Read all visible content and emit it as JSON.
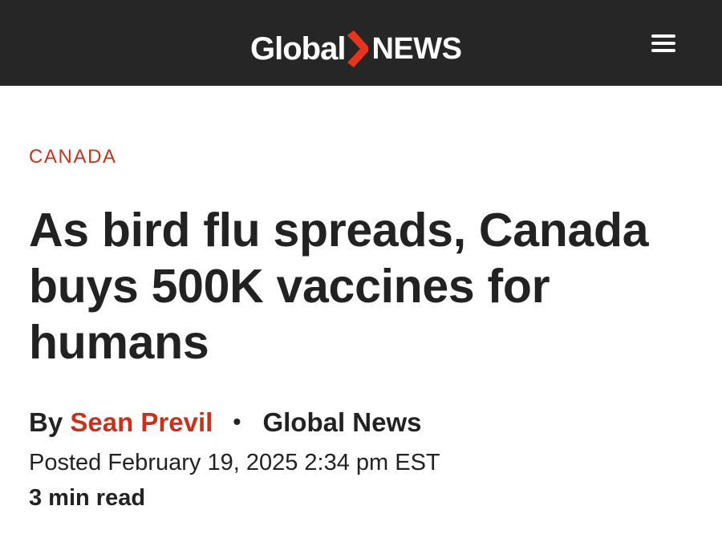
{
  "header": {
    "logo_global": "Global",
    "logo_news": "NEWS",
    "menu_icon": "hamburger-menu-icon",
    "background_color": "#262626",
    "accent_color": "#e8341c"
  },
  "article": {
    "section": "CANADA",
    "headline": "As bird flu spreads, Canada buys 500K vaccines for humans",
    "byline_prefix": "By",
    "author": "Sean Previl",
    "separator": "•",
    "outlet": "Global News",
    "posted": "Posted February 19, 2025 2:34 pm EST",
    "read_time": "3 min read",
    "accent_color": "#c8311a"
  }
}
